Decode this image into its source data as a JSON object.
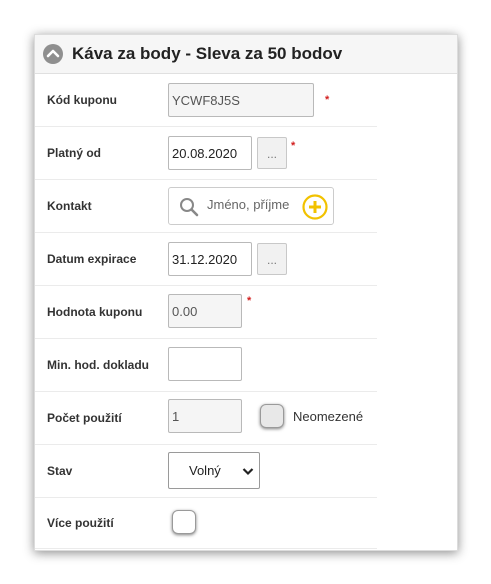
{
  "panel": {
    "title": "Káva za body - Sleva za 50 bodov",
    "collapse_icon": "chevron-up-icon"
  },
  "form": {
    "kod_kuponu": {
      "label": "Kód kuponu",
      "value": "YCWF8J5S",
      "required": "*"
    },
    "platny_od": {
      "label": "Platný od",
      "value": "20.08.2020",
      "picker_label": "...",
      "required": "*"
    },
    "kontakt": {
      "label": "Kontakt",
      "placeholder": "Jméno, příjme",
      "search_icon": "search-icon",
      "add_icon": "plus-circle-icon"
    },
    "datum_expirace": {
      "label": "Datum expirace",
      "value": "31.12.2020",
      "picker_label": "..."
    },
    "hodnota_kuponu": {
      "label": "Hodnota kuponu",
      "value": "0.00",
      "required": "*"
    },
    "min_hod_dokladu": {
      "label": "Min. hod. dokladu",
      "value": ""
    },
    "pocet_pouziti": {
      "label": "Počet použití",
      "value": "1",
      "unlimited_label": "Neomezené",
      "unlimited_checked": false
    },
    "stav": {
      "label": "Stav",
      "selected": "Volný"
    },
    "vice_pouziti": {
      "label": "Více použití",
      "checked": false
    }
  },
  "colors": {
    "required": "#d21f1f",
    "add_icon": "#f2c200",
    "header_bg": "#f6f6f6"
  }
}
